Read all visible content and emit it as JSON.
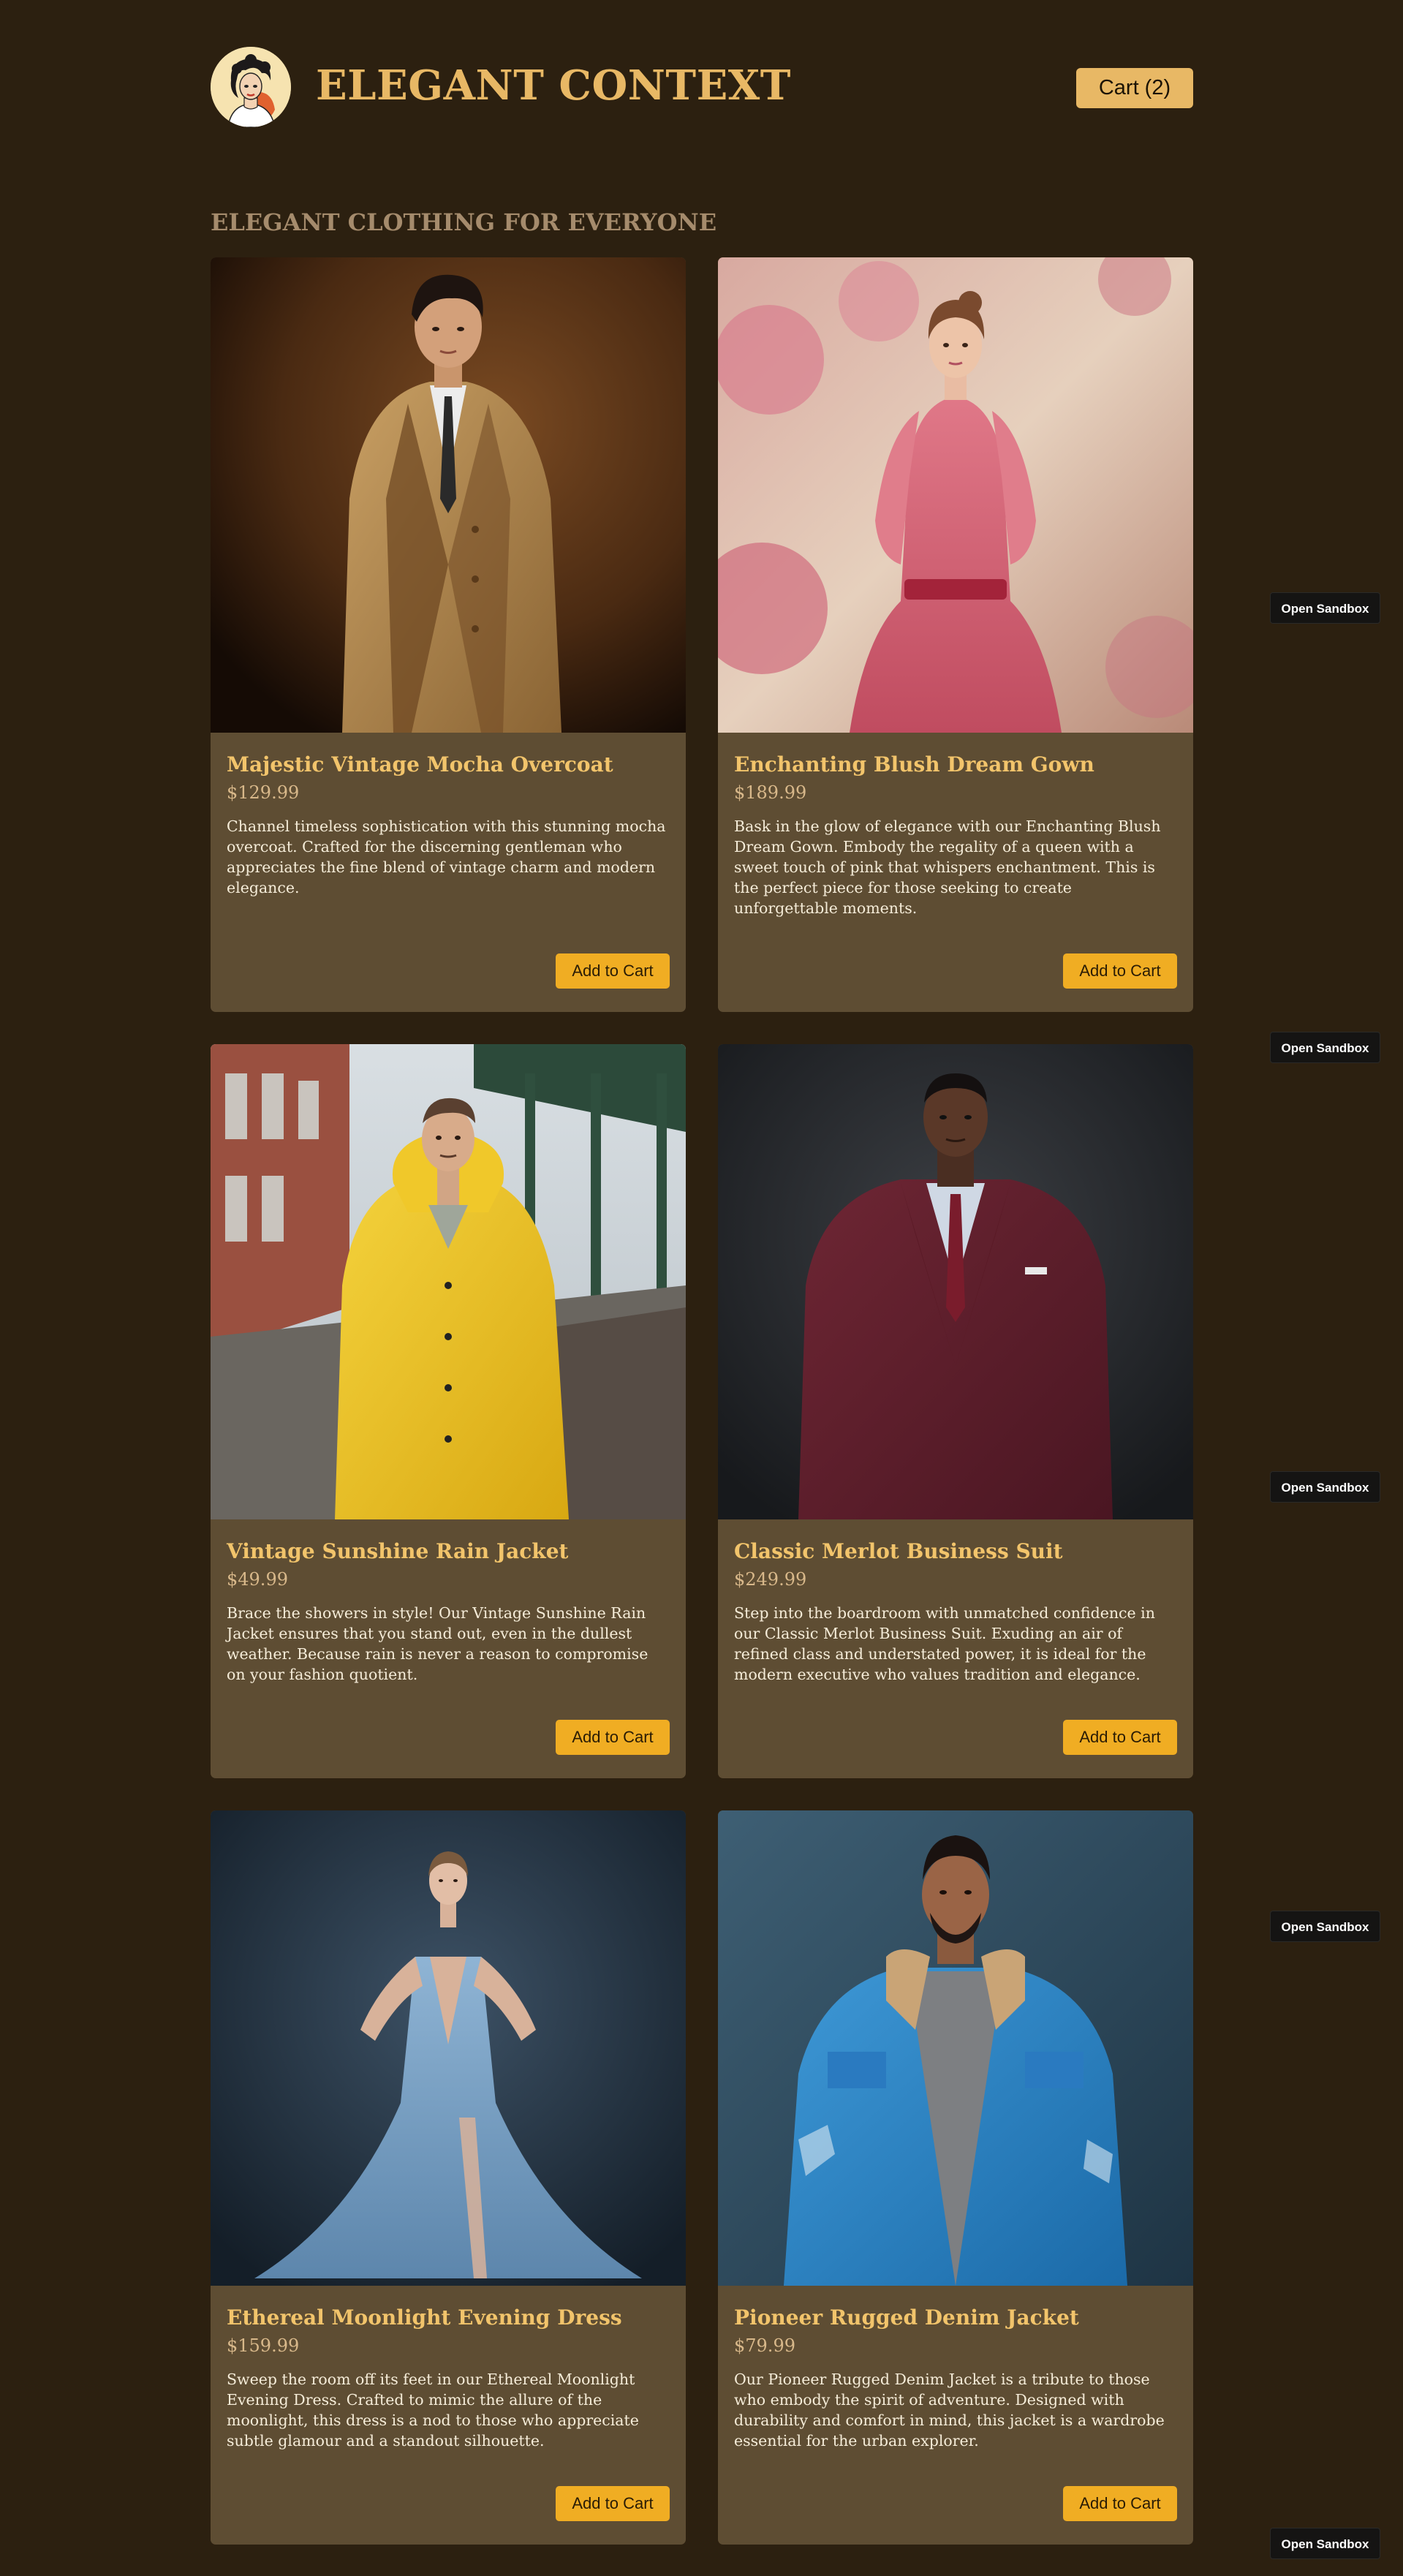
{
  "header": {
    "logo_icon": "vintage-woman-portrait-icon",
    "brand": "ELEGANT CONTEXT",
    "cart_label": "Cart (2)"
  },
  "tagline": "ELEGANT CLOTHING FOR EVERYONE",
  "products": [
    {
      "title": "Majestic Vintage Mocha Overcoat",
      "price": "$129.99",
      "description": "Channel timeless sophistication with this stunning mocha overcoat. Crafted for the discerning gentleman who appreciates the fine blend of vintage charm and modern elegance.",
      "button": "Add to Cart"
    },
    {
      "title": "Enchanting Blush Dream Gown",
      "price": "$189.99",
      "description": "Bask in the glow of elegance with our Enchanting Blush Dream Gown. Embody the regality of a queen with a sweet touch of pink that whispers enchantment. This is the perfect piece for those seeking to create unforgettable moments.",
      "button": "Add to Cart"
    },
    {
      "title": "Vintage Sunshine Rain Jacket",
      "price": "$49.99",
      "description": "Brace the showers in style! Our Vintage Sunshine Rain Jacket ensures that you stand out, even in the dullest weather. Because rain is never a reason to compromise on your fashion quotient.",
      "button": "Add to Cart"
    },
    {
      "title": "Classic Merlot Business Suit",
      "price": "$249.99",
      "description": "Step into the boardroom with unmatched confidence in our Classic Merlot Business Suit. Exuding an air of refined class and understated power, it is ideal for the modern executive who values tradition and elegance.",
      "button": "Add to Cart"
    },
    {
      "title": "Ethereal Moonlight Evening Dress",
      "price": "$159.99",
      "description": "Sweep the room off its feet in our Ethereal Moonlight Evening Dress. Crafted to mimic the allure of the moonlight, this dress is a nod to those who appreciate subtle glamour and a standout silhouette.",
      "button": "Add to Cart"
    },
    {
      "title": "Pioneer Rugged Denim Jacket",
      "price": "$79.99",
      "description": "Our Pioneer Rugged Denim Jacket is a tribute to those who embody the spirit of adventure. Designed with durability and comfort in mind, this jacket is a wardrobe essential for the urban explorer.",
      "button": "Add to Cart"
    }
  ],
  "sandbox_label": "Open Sandbox",
  "colors": {
    "background": "#2c2010",
    "card": "#5e4d33",
    "accent": "#e8b865",
    "button": "#f0ad23",
    "title": "#f2c46b"
  }
}
